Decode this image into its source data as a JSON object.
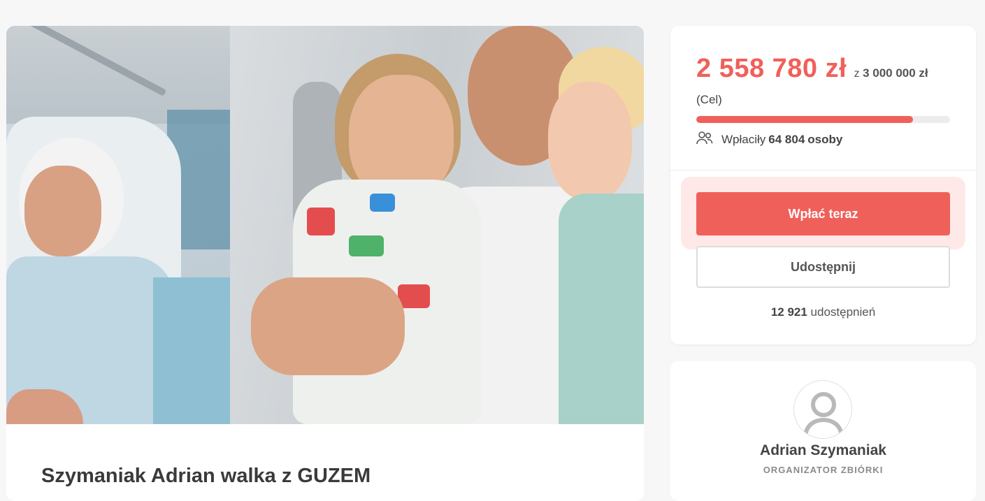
{
  "campaign": {
    "title": "Szymaniak Adrian walka z GUZEM"
  },
  "donation": {
    "raised": "2 558 780 zł",
    "goal_prefix": "z",
    "goal": "3 000 000 zł",
    "goal_label": "(Cel)",
    "progress_percent": 85.3,
    "donors_prefix": "Wpłaciły",
    "donors_count": "64 804",
    "donors_suffix": "osoby",
    "pay_button": "Wpłać teraz",
    "share_button": "Udostępnij",
    "shares_count": "12 921",
    "shares_label": "udostępnień",
    "accent_color": "#f0605a"
  },
  "organizer": {
    "name": "Adrian Szymaniak",
    "role": "ORGANIZATOR ZBIÓRKI"
  },
  "icons": [
    "people-icon",
    "avatar-placeholder-icon"
  ]
}
